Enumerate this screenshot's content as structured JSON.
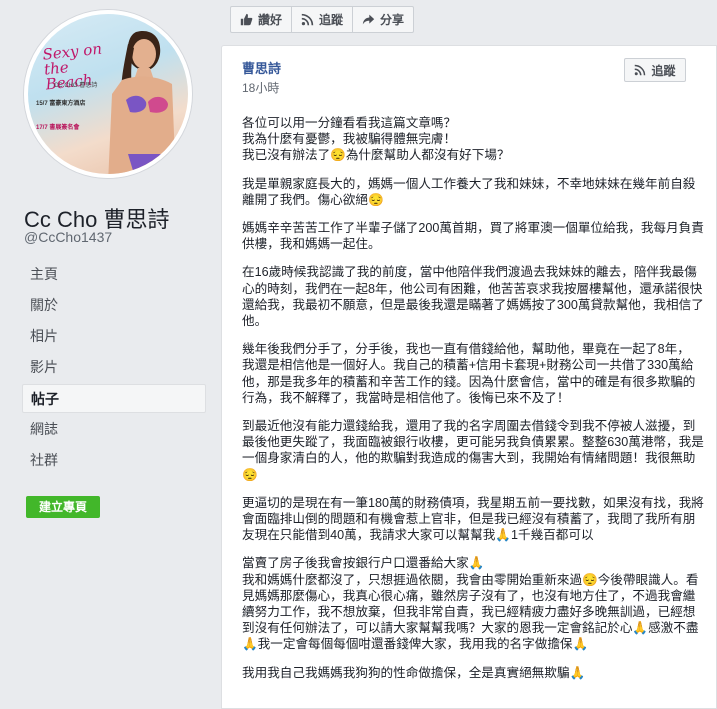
{
  "page": {
    "name": "Cc Cho 曹思詩",
    "handle": "@CcCho1437",
    "poster_title": "Sexy on the Beach",
    "poster_sub": "CC CHO 曹思詩",
    "poster_date1": "15/7 富豪東方酒店",
    "poster_date2": "17/7 書展簽名會"
  },
  "nav": [
    {
      "label": "主頁"
    },
    {
      "label": "關於"
    },
    {
      "label": "相片"
    },
    {
      "label": "影片"
    },
    {
      "label": "帖子",
      "active": true
    },
    {
      "label": "網誌"
    },
    {
      "label": "社群"
    }
  ],
  "create_page_label": "建立專頁",
  "top_actions": {
    "like": "讚好",
    "follow": "追蹤",
    "share": "分享"
  },
  "post": {
    "author": "曹思詩",
    "timestamp": "18小時",
    "follow_label": "追蹤",
    "paragraphs": [
      "各位可以用一分鐘看看我這篇文章嗎？\n我為什麼有憂鬱，我被騙得體無完膚！\n我已沒有辦法了😔為什麼幫助人都沒有好下場？",
      "我是單親家庭長大的，媽媽一個人工作養大了我和妹妹，不幸地妹妹在幾年前自殺離開了我們。傷心欲絕😔",
      "媽媽辛辛苦苦工作了半輩子儲了200萬首期，買了將軍澳一個單位給我，我每月負責供樓，我和媽媽一起住。",
      "在16歲時候我認識了我的前度，當中他陪伴我們渡過去我妹妹的離去，陪伴我最傷心的時刻，我們在一起8年，他公司有困難，他苦苦哀求我按層樓幫他，還承諾很快還給我，我最初不願意，但是最後我還是瞞著了媽媽按了300萬貸款幫他，我相信了他。",
      "幾年後我們分手了，分手後，我也一直有借錢給他，幫助他，畢竟在一起了8年，\n我還是相信他是一個好人。我自己的積蓄+信用卡套現+財務公司一共借了330萬給他，那是我多年的積蓄和辛苦工作的錢。因為什麼會信，當中的確是有很多欺騙的行為，我不解釋了，我當時是相信他了。後悔已來不及了！",
      "到最近他沒有能力還錢給我，還用了我的名字周圍去借錢令到我不停被人滋擾，到最後他更失蹤了，我面臨被銀行收樓，更可能另我負債累累。整整630萬港幣，我是一個身家清白的人，他的欺騙對我造成的傷害大到，我開始有情緒問題！我很無助😔",
      "更逼切的是現在有一筆180萬的財務債項，我星期五前一要找數，如果沒有找，我將會面臨排山倒的問題和有機會惹上官非，但是我已經沒有積蓄了，我問了我所有朋友現在只能借到40萬，我請求大家可以幫幫我🙏1千幾百都可以",
      "當賣了房子後我會按銀行户口還番給大家🙏\n我和媽媽什麼都沒了，只想捱過依關，我會由零開始重新來過😔今後帶眼識人。看見媽媽那麼傷心，我真心很心痛，雖然房子沒有了，也沒有地方住了，不過我會繼續努力工作，我不想放棄，但我非常自責，我已經精疲力盡好多晚無訓過，已經想到沒有任何辦法了，可以請大家幫幫我嗎？大家的恩我一定會銘記於心🙏感激不盡🙏我一定會每個每個咁還番錢俾大家，我用我的名字做擔保🙏",
      "我用我自己我媽媽我狗狗的性命做擔保，全是真實絕無欺騙🙏"
    ]
  },
  "colors": {
    "link": "#365899",
    "green": "#42b72a",
    "background": "#e9ebee"
  }
}
